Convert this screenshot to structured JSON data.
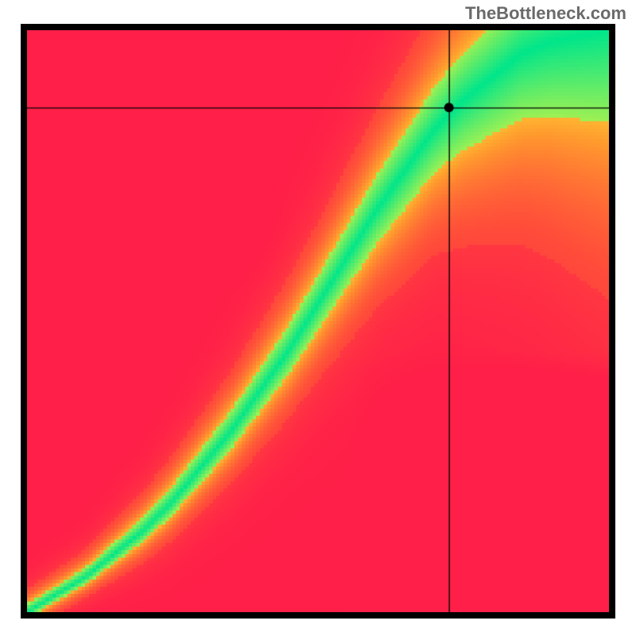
{
  "watermark": "TheBottleneck.com",
  "colors": {
    "frame": "#000000",
    "crosshair": "#000000",
    "marker": "#000000"
  },
  "chart_data": {
    "type": "heatmap",
    "title": "",
    "xlabel": "",
    "ylabel": "",
    "xlim": [
      0,
      1
    ],
    "ylim": [
      0,
      1
    ],
    "grid": false,
    "legend_position": "none",
    "description": "Bottleneck field. Color encodes bottleneck severity: green = balanced (0), yellow = mild, red = severe (1). Field is a function of normalized X and Y scores; balanced region is a curved diagonal band.",
    "color_scale": [
      {
        "value": 0.0,
        "color": "#00e68b"
      },
      {
        "value": 0.18,
        "color": "#b8f24a"
      },
      {
        "value": 0.35,
        "color": "#ffe339"
      },
      {
        "value": 0.55,
        "color": "#ff9c2e"
      },
      {
        "value": 0.78,
        "color": "#ff4f3a"
      },
      {
        "value": 1.0,
        "color": "#ff1f49"
      }
    ],
    "balance_curve_samples": [
      {
        "x": 0.0,
        "y": 0.0
      },
      {
        "x": 0.05,
        "y": 0.03
      },
      {
        "x": 0.1,
        "y": 0.06
      },
      {
        "x": 0.15,
        "y": 0.1
      },
      {
        "x": 0.2,
        "y": 0.14
      },
      {
        "x": 0.25,
        "y": 0.19
      },
      {
        "x": 0.3,
        "y": 0.25
      },
      {
        "x": 0.35,
        "y": 0.31
      },
      {
        "x": 0.4,
        "y": 0.38
      },
      {
        "x": 0.45,
        "y": 0.45
      },
      {
        "x": 0.5,
        "y": 0.53
      },
      {
        "x": 0.55,
        "y": 0.61
      },
      {
        "x": 0.6,
        "y": 0.69
      },
      {
        "x": 0.65,
        "y": 0.76
      },
      {
        "x": 0.7,
        "y": 0.83
      },
      {
        "x": 0.75,
        "y": 0.88
      },
      {
        "x": 0.8,
        "y": 0.92
      },
      {
        "x": 0.85,
        "y": 0.96
      },
      {
        "x": 0.9,
        "y": 0.98
      },
      {
        "x": 0.95,
        "y": 0.99
      },
      {
        "x": 1.0,
        "y": 1.0
      }
    ],
    "band_halfwidth_samples": [
      {
        "x": 0.0,
        "w": 0.01
      },
      {
        "x": 0.1,
        "w": 0.012
      },
      {
        "x": 0.2,
        "w": 0.018
      },
      {
        "x": 0.3,
        "w": 0.025
      },
      {
        "x": 0.4,
        "w": 0.032
      },
      {
        "x": 0.5,
        "w": 0.04
      },
      {
        "x": 0.6,
        "w": 0.05
      },
      {
        "x": 0.7,
        "w": 0.062
      },
      {
        "x": 0.8,
        "w": 0.08
      },
      {
        "x": 0.9,
        "w": 0.1
      },
      {
        "x": 1.0,
        "w": 0.12
      }
    ],
    "marker": {
      "x": 0.725,
      "y": 0.867
    },
    "crosshair": {
      "x": 0.725,
      "y": 0.867
    },
    "marker_value_estimate": 0.2,
    "heatmap_resolution": 160
  }
}
